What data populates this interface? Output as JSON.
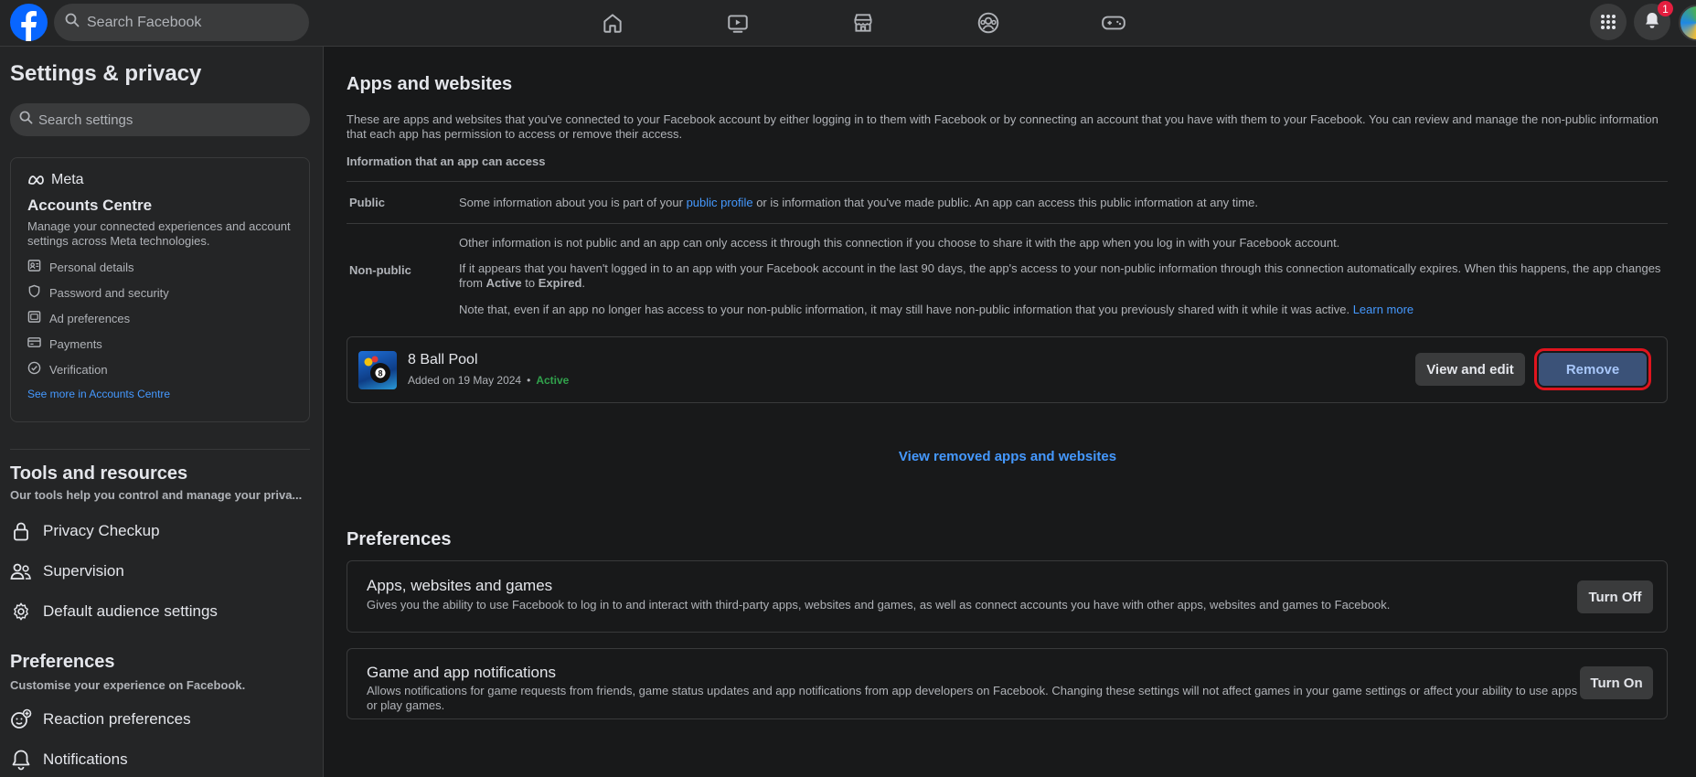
{
  "topbar": {
    "search_placeholder": "Search Facebook",
    "notification_count": "1"
  },
  "sidebar": {
    "title": "Settings & privacy",
    "search_placeholder": "Search settings",
    "accounts": {
      "meta_label": "Meta",
      "title": "Accounts Centre",
      "description": "Manage your connected experiences and account settings across Meta technologies.",
      "items": [
        "Personal details",
        "Password and security",
        "Ad preferences",
        "Payments",
        "Verification"
      ],
      "see_more": "See more in Accounts Centre"
    },
    "tools": {
      "title": "Tools and resources",
      "subtitle": "Our tools help you control and manage your priva...",
      "items": [
        "Privacy Checkup",
        "Supervision",
        "Default audience settings"
      ]
    },
    "preferences": {
      "title": "Preferences",
      "subtitle": "Customise your experience on Facebook.",
      "items": [
        "Reaction preferences",
        "Notifications"
      ]
    }
  },
  "main": {
    "title": "Apps and websites",
    "intro": "These are apps and websites that you've connected to your Facebook account by either logging in to them with Facebook or by connecting an account that you have with them to your Facebook. You can review and manage the non-public information that each app has permission to access or remove their access.",
    "info_heading": "Information that an app can access",
    "public": {
      "label": "Public",
      "text_before": "Some information about you is part of your ",
      "link": "public profile",
      "text_after": " or is information that you've made public. An app can access this public information at any time."
    },
    "nonpublic": {
      "label": "Non-public",
      "p1": "Other information is not public and an app can only access it through this connection if you choose to share it with the app when you log in with your Facebook account.",
      "p2_before": "If it appears that you haven't logged in to an app with your Facebook account in the last 90 days, the app's access to your non-public information through this connection automatically expires. When this happens, the app changes from ",
      "p2_active": "Active",
      "p2_mid": " to ",
      "p2_expired": "Expired",
      "p2_end": ".",
      "p3": "Note that, even if an app no longer has access to your non-public information, it may still have non-public information that you previously shared with it while it was active. ",
      "learn_more": "Learn more"
    },
    "app": {
      "name": "8 Ball Pool",
      "added": "Added on 19 May 2024",
      "bullet": "•",
      "status": "Active",
      "view_edit_label": "View and edit",
      "remove_label": "Remove"
    },
    "view_removed": "View removed apps and websites",
    "preferences_title": "Preferences",
    "pref_items": [
      {
        "title": "Apps, websites and games",
        "description": "Gives you the ability to use Facebook to log in to and interact with third-party apps, websites and games, as well as connect accounts you have with other apps, websites and games to Facebook.",
        "button": "Turn Off"
      },
      {
        "title": "Game and app notifications",
        "description": "Allows notifications for game requests from friends, game status updates and app notifications from app developers on Facebook. Changing these settings will not affect games in your game settings or affect your ability to use apps or play games.",
        "button": "Turn On"
      }
    ]
  },
  "colors": {
    "accent": "#0866ff",
    "link": "#4599ff",
    "active_green": "#31a24c",
    "highlight_red": "#e0141e"
  },
  "icons": {
    "nav": [
      "home-icon",
      "video-icon",
      "marketplace-icon",
      "groups-icon",
      "gaming-icon"
    ]
  }
}
